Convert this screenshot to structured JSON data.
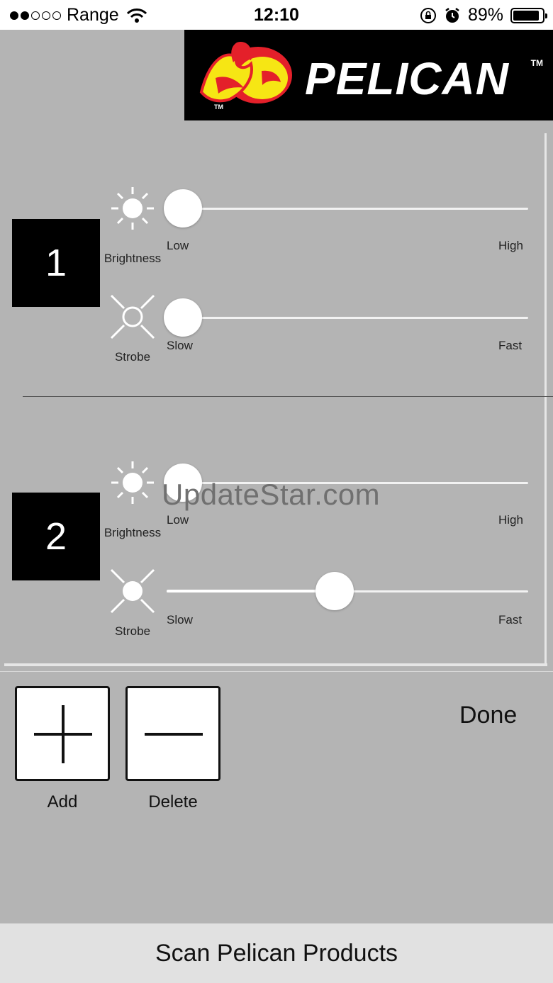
{
  "status_bar": {
    "carrier": "Range",
    "time": "12:10",
    "battery_percent": "89%",
    "battery_level": 0.89,
    "signal_bars": 2,
    "icons": [
      "wifi-icon",
      "rotation-lock-icon",
      "alarm-icon",
      "battery-icon"
    ]
  },
  "logo": {
    "brand": "PELICAN",
    "tm": "TM",
    "colors": {
      "red": "#e4202a",
      "yellow": "#f6e614",
      "background": "#000000"
    }
  },
  "lights": [
    {
      "number": "1",
      "brightness": {
        "label": "Brightness",
        "low": "Low",
        "high": "High",
        "value": 0.0
      },
      "strobe": {
        "label": "Strobe",
        "slow": "Slow",
        "fast": "Fast",
        "value": 0.0
      }
    },
    {
      "number": "2",
      "brightness": {
        "label": "Brightness",
        "low": "Low",
        "high": "High",
        "value": 0.0
      },
      "strobe": {
        "label": "Strobe",
        "slow": "Slow",
        "fast": "Fast",
        "value": 0.47
      }
    }
  ],
  "watermark": "UpdateStar.com",
  "controls": {
    "add_label": "Add",
    "delete_label": "Delete",
    "done_label": "Done"
  },
  "scan_button": "Scan Pelican Products"
}
